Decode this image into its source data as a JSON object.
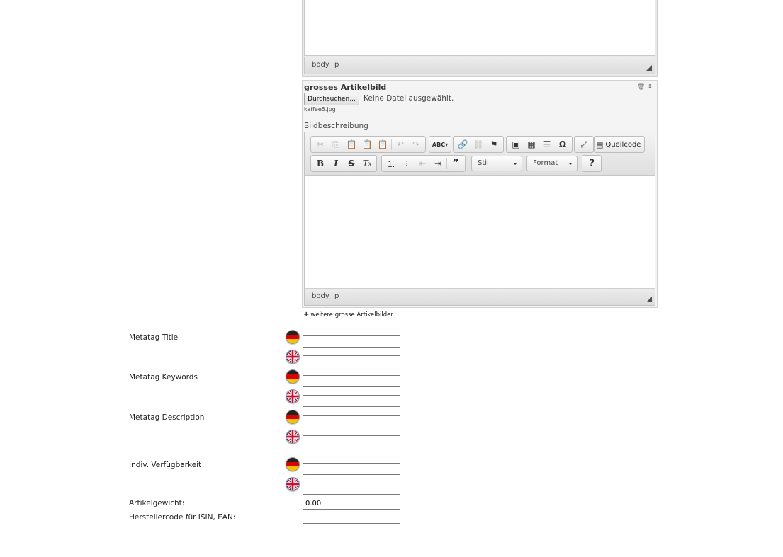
{
  "top_editor": {
    "path_items": [
      "body",
      "p"
    ]
  },
  "image_block": {
    "title": "grosses Artikelbild",
    "tools_icons": [
      "trash-icon",
      "move-icon"
    ],
    "tools_text": "🗑 ⇕",
    "browse_label": "Durchsuchen...",
    "no_file_text": "Keine Datei ausgewählt.",
    "current_file": "kaffee5.jpg",
    "description_label": "Bildbeschreibung",
    "editor": {
      "toolbar_row1": {
        "clipboard": [
          "cut-icon",
          "copy-icon",
          "paste-icon",
          "paste-text-icon",
          "paste-word-icon"
        ],
        "history": [
          "undo-icon",
          "redo-icon"
        ],
        "spell": [
          "spellcheck-icon"
        ],
        "links": [
          "link-icon",
          "unlink-icon",
          "anchor-icon"
        ],
        "insert": [
          "image-icon",
          "table-icon",
          "horizontal-line-icon",
          "special-char-icon"
        ],
        "maximize": [
          "maximize-icon"
        ],
        "source_label": "Quellcode"
      },
      "toolbar_row2": {
        "basic": [
          "bold-icon",
          "italic-icon",
          "strike-icon",
          "remove-format-icon"
        ],
        "lists": [
          "numbered-list-icon",
          "bulleted-list-icon",
          "outdent-icon",
          "indent-icon",
          "blockquote-icon"
        ],
        "style_combo": "Stil",
        "format_combo": "Format",
        "help_label": "?"
      },
      "path_items": [
        "body",
        "p"
      ]
    }
  },
  "more_images_link": "weitere grosse Artikelbilder",
  "fields": {
    "meta_title": {
      "label": "Metatag Title",
      "de_value": "",
      "en_value": ""
    },
    "meta_keywords": {
      "label": "Metatag Keywords",
      "de_value": "",
      "en_value": ""
    },
    "meta_description": {
      "label": "Metatag Description",
      "de_value": "",
      "en_value": ""
    },
    "availability": {
      "label": "Indiv. Verfügbarkeit",
      "de_value": "",
      "en_value": ""
    },
    "weight": {
      "label": "Artikelgewicht:",
      "value": "0.00"
    },
    "isin": {
      "label": "Herstellercode für ISIN, EAN:",
      "value": ""
    }
  },
  "flags": {
    "de": "german-flag-icon",
    "en": "uk-flag-icon"
  }
}
